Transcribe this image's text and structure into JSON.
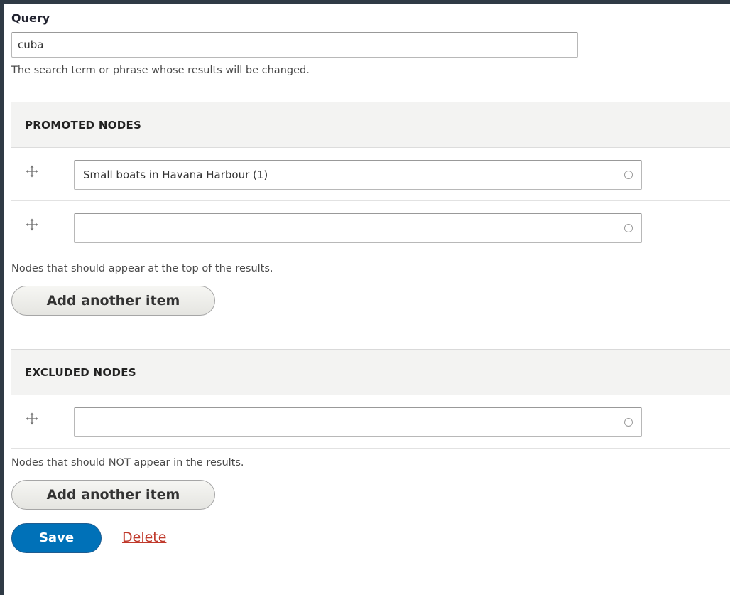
{
  "query": {
    "label": "Query",
    "value": "cuba",
    "description": "The search term or phrase whose results will be changed."
  },
  "promoted": {
    "header": "PROMOTED NODES",
    "rows": [
      {
        "value": "Small boats in Havana Harbour (1)"
      },
      {
        "value": ""
      }
    ],
    "description": "Nodes that should appear at the top of the results.",
    "add_label": "Add another item"
  },
  "excluded": {
    "header": "EXCLUDED NODES",
    "rows": [
      {
        "value": ""
      }
    ],
    "description": "Nodes that should NOT appear in the results.",
    "add_label": "Add another item"
  },
  "actions": {
    "save_label": "Save",
    "delete_label": "Delete"
  },
  "icons": {
    "drag_handle": "move-icon",
    "autocomplete": "throbber-icon"
  },
  "colors": {
    "primary": "#0071b8",
    "link_danger": "#c0392b"
  }
}
